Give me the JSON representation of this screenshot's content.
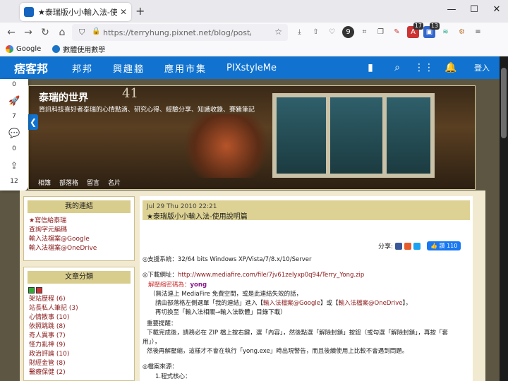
{
  "browser": {
    "tab_title": "★泰瑞版小小輸入法-使用說明",
    "tab_close": "✕",
    "new_tab": "+",
    "url": "https://terryhung.pixnet.net/blog/post/266",
    "bookmarks": [
      "Google",
      "數體使用數學"
    ],
    "toolbar_badges": [
      "17",
      "13"
    ],
    "window_controls": [
      "—",
      "☐",
      "✕"
    ]
  },
  "site": {
    "logo": "痞客邦",
    "nav": [
      "邦邦",
      "興趣牆",
      "應用市集",
      "PIXstyleMe"
    ],
    "login": "登入"
  },
  "social": {
    "counts": [
      "0",
      "7",
      "0",
      "12"
    ]
  },
  "blog": {
    "title": "泰瑞的世界",
    "description": "資訊科技喜好者泰瑞的心情點滴、研究心得、經驗分享、知識收錄、賽豬筆記",
    "banner_number": "41",
    "banner_nav": [
      "相簿",
      "部落格",
      "留言",
      "名片"
    ]
  },
  "sidebar": {
    "links_title": "我的連結",
    "links": [
      "★寫信給泰瑞",
      "查詢字元編碼",
      "輸入法檔案@Google",
      "輸入法檔案@OneDrive"
    ],
    "categories_title": "文章分類",
    "categories": [
      "架站歷程 (6)",
      "站長私人筆記 (3)",
      "心情散事 (10)",
      "依照跳跳 (8)",
      "奇人異事 (7)",
      "怪力亂神 (9)",
      "政治評論 (10)",
      "財經金管 (8)",
      "醫療保健 (2)"
    ]
  },
  "post": {
    "date": "Jul 29 Thu 2010 22:21",
    "title": "★泰瑞版小小輸入法-使用說明篇",
    "share_label": "分享:",
    "like_label": "👍 讚 110",
    "support": "◎支援系統：32/64 bits Windows XP/Vista/7/8.x/10/Server",
    "download_label": "◎下載網址：",
    "download_url": "http://www.mediafire.com/file/7jv61zelyxp0q94/Terry_Yong.zip",
    "unzip_label": "解壓縮密碼為：",
    "unzip_pw": "yong",
    "note1": "（無法連上 MediaFire 免費空間，或是此連結失效的話，",
    "note2a": "請由部落格左側選單「我的連結」進入【",
    "note2_link1": "輸入法檔案@Google",
    "note2b": "】或【",
    "note2_link2": "輸入法檔案@OneDrive",
    "note2c": "】，",
    "note3": "再切換至「輸入法相關→輸入法軟體」目錄下載）",
    "important": "重要提醒：",
    "tip1": "下載完成後，請務必在 ZIP 檔上按右鍵，選「內容」，然後點選「解除封鎖」按鈕（或勾選「解除封鎖」，再按「套",
    "tip2": "用」），",
    "tip3": "然後再解壓縮，這樣才不會在執行「yong.exe」時出現警告，而且後續使用上比較不會遇到問題。",
    "source_label": "◎檔案來源：",
    "source1": "1.程式核心："
  }
}
